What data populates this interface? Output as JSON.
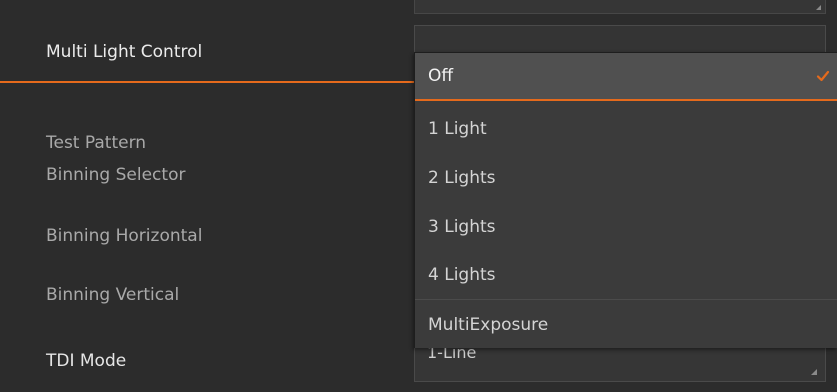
{
  "properties": [
    {
      "label": "Multi Light Control",
      "state": "active"
    },
    {
      "label": "Test Pattern",
      "state": "normal"
    },
    {
      "label": "Binning Selector",
      "state": "normal"
    },
    {
      "label": "Binning Horizontal",
      "state": "normal"
    },
    {
      "label": "Binning Vertical",
      "state": "normal"
    },
    {
      "label": "TDI Mode",
      "state": "bright"
    }
  ],
  "tdi_mode_value": "1-Line",
  "dropdown": {
    "selected": "Off",
    "options": [
      "Off",
      "1 Light",
      "2 Lights",
      "3 Lights",
      "4 Lights",
      "MultiExposure"
    ]
  },
  "colors": {
    "accent": "#e56a1c",
    "background": "#2c2c2c",
    "dropdown_bg": "#3b3b3b",
    "selected_bg": "#505050"
  },
  "icons": {
    "selected_marker": "check-icon",
    "field_corner": "resize-grip-icon"
  }
}
